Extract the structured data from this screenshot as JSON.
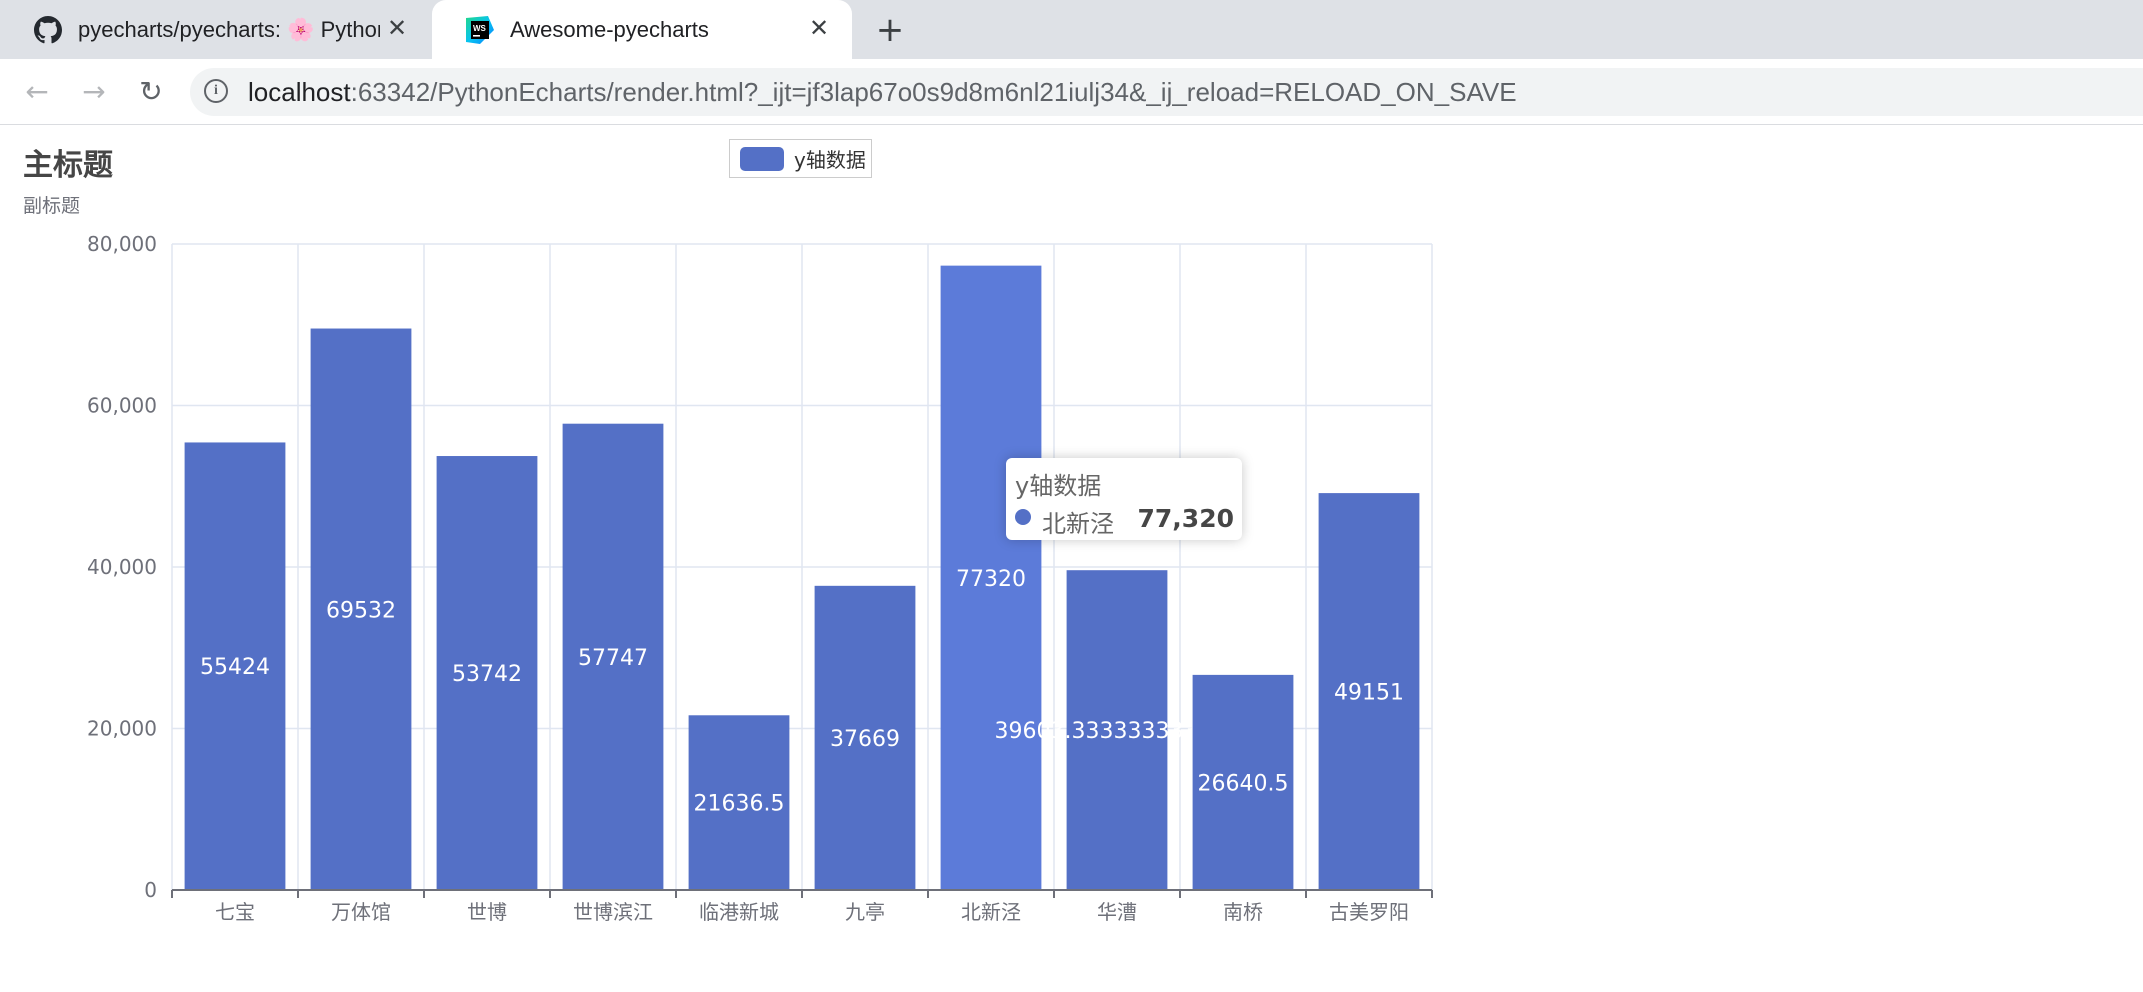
{
  "browser": {
    "tabs": [
      {
        "title": "pyecharts/pyecharts: 🌸 Python Echarts Plotting Library",
        "favicon": "github-icon",
        "active": false
      },
      {
        "title": "Awesome-pyecharts",
        "favicon": "webstorm-icon",
        "active": true
      }
    ],
    "new_tab_icon": "plus-icon",
    "close_icon": "close-icon",
    "url_host": "localhost",
    "url_rest": ":63342/PythonEcharts/render.html?_ijt=jf3lap67o0s9d8m6nl21iulj34&_ij_reload=RELOAD_ON_SAVE"
  },
  "colors": {
    "bar": "#5470c6",
    "bar_highlight": "#5c7bd9",
    "axis_text": "#6e7079",
    "grid": "#e0e6f1"
  },
  "chart_data": {
    "type": "bar",
    "title": "主标题",
    "subtitle": "副标题",
    "categories": [
      "七宝",
      "万体馆",
      "世博",
      "世博滨江",
      "临港新城",
      "九亭",
      "北新泾",
      "华漕",
      "南桥",
      "古美罗阳"
    ],
    "series": [
      {
        "name": "y轴数据",
        "values": [
          55424,
          69532,
          53742,
          57747,
          21636.5,
          37669,
          77320,
          39603.333333333336,
          26640.5,
          49151
        ],
        "labels": [
          "55424",
          "69532",
          "53742",
          "57747",
          "21636.5",
          "37669",
          "77320",
          "39603.333333333336",
          "26640.5",
          "49151"
        ]
      }
    ],
    "ylim": [
      0,
      80000
    ],
    "yticks": [
      "0",
      "20,000",
      "40,000",
      "60,000",
      "80,000"
    ],
    "grid": true,
    "legend_position": "top-center",
    "highlighted_category": "北新泾"
  },
  "tooltip": {
    "title": "y轴数据",
    "name": "北新泾",
    "value": "77,320"
  }
}
